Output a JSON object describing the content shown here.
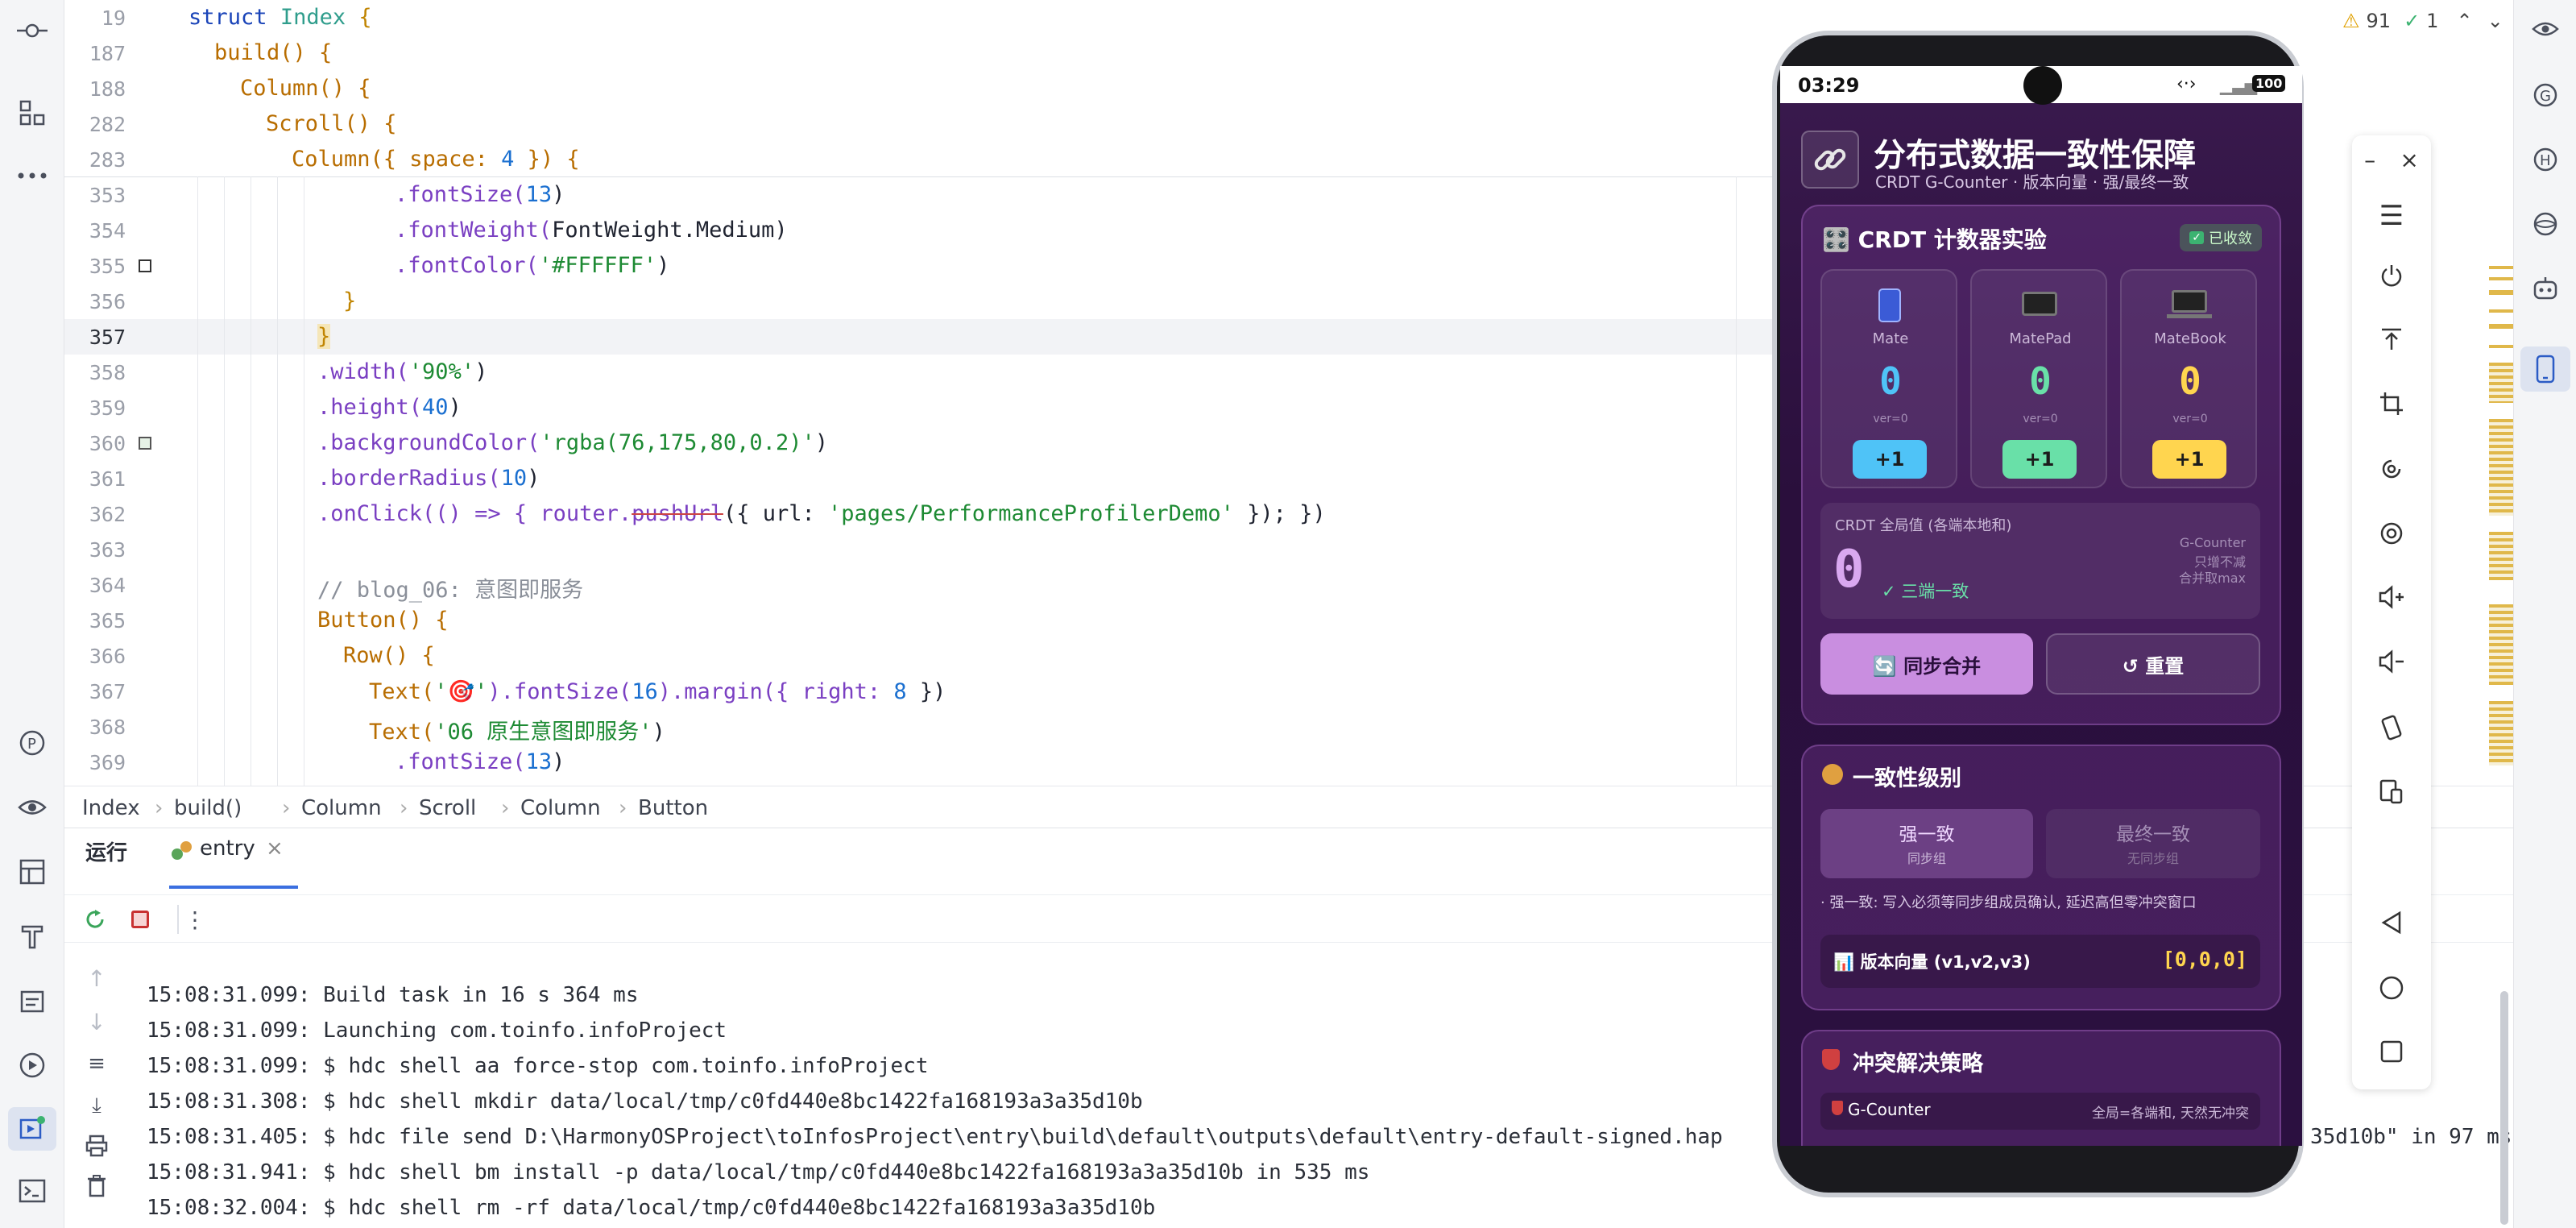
{
  "editor": {
    "lines": [
      {
        "n": "19"
      },
      {
        "n": "187"
      },
      {
        "n": "188"
      },
      {
        "n": "282"
      },
      {
        "n": "283"
      },
      {
        "n": "353"
      },
      {
        "n": "354"
      },
      {
        "n": "355"
      },
      {
        "n": "356"
      },
      {
        "n": "357"
      },
      {
        "n": "358"
      },
      {
        "n": "359"
      },
      {
        "n": "360"
      },
      {
        "n": "361"
      },
      {
        "n": "362"
      },
      {
        "n": "363"
      },
      {
        "n": "364"
      },
      {
        "n": "365"
      },
      {
        "n": "366"
      },
      {
        "n": "367"
      },
      {
        "n": "368"
      },
      {
        "n": "369"
      }
    ],
    "code": {
      "l19a": "struct",
      "l19b": "Index",
      "l19c": "{",
      "l187": "build() {",
      "l188": "Column() {",
      "l282": "Scroll() {",
      "l283a": "Column({ space: ",
      "l283b": "4",
      "l283c": " }) {",
      "l353a": ".fontSize(",
      "l353b": "13",
      "l353c": ")",
      "l354a": ".fontWeight(",
      "l354b": "FontWeight",
      "l354c": ".Medium)",
      "l355a": ".fontColor(",
      "l355b": "'#FFFFFF'",
      "l355c": ")",
      "l356": "}",
      "l357": "}",
      "l358a": ".width(",
      "l358b": "'90%'",
      "l358c": ")",
      "l359a": ".height(",
      "l359b": "40",
      "l359c": ")",
      "l360a": ".backgroundColor(",
      "l360b": "'rgba(76,175,80,0.2)'",
      "l360c": ")",
      "l361a": ".borderRadius(",
      "l361b": "10",
      "l361c": ")",
      "l362a": ".onClick(() => { router.",
      "l362b": "pushUrl",
      "l362c": "({ url: ",
      "l362d": "'pages/PerformanceProfilerDemo'",
      "l362e": " }); })",
      "l364": "// blog_06: 意图即服务",
      "l365": "Button() {",
      "l366": "Row() {",
      "l367a": "Text(",
      "l367b": "'🎯'",
      "l367c": ").fontSize(",
      "l367d": "16",
      "l367e": ").margin({ right: ",
      "l367f": "8",
      "l367g": " })",
      "l368a": "Text(",
      "l368b": "'06 原生意图即服务'",
      "l368c": ")",
      "l369a": ".fontSize(",
      "l369b": "13",
      "l369c": ")"
    },
    "problems": {
      "warnings": "91",
      "ok": "1"
    }
  },
  "breadcrumb": [
    "Index",
    "build()",
    "Column",
    "Scroll",
    "Column",
    "Button"
  ],
  "run_panel": {
    "tab_run": "运行",
    "tab_entry": "entry",
    "console": [
      "15:08:31.099: Build task in 16 s 364 ms",
      "15:08:31.099: Launching com.toinfo.infoProject",
      "15:08:31.099: $ hdc shell aa force-stop com.toinfo.infoProject",
      "15:08:31.308: $ hdc shell mkdir data/local/tmp/c0fd440e8bc1422fa168193a3a35d10b",
      "15:08:31.405: $ hdc file send D:\\HarmonyOSProject\\toInfosProject\\entry\\build\\default\\outputs\\default\\entry-default-signed.hap",
      "15:08:31.941: $ hdc shell bm install -p data/local/tmp/c0fd440e8bc1422fa168193a3a35d10b in 535 ms",
      "15:08:32.004: $ hdc shell rm -rf data/local/tmp/c0fd440e8bc1422fa168193a3a35d10b"
    ],
    "console_overflow": "35d10b\" in 97 ms"
  },
  "phone": {
    "time": "03:29",
    "battery": "100",
    "app_title": "分布式数据一致性保障",
    "app_subtitle": "CRDT G-Counter · 版本向量 · 强/最终一致",
    "crdt_card": {
      "title": "🎛️ CRDT 计数器实验",
      "badge": "已收敛",
      "devices": [
        {
          "name": "Mate",
          "value": "0",
          "ver": "ver=0",
          "button": "+1",
          "color": "#4fc3f7"
        },
        {
          "name": "MatePad",
          "value": "0",
          "ver": "ver=0",
          "button": "+1",
          "color": "#69e0a8"
        },
        {
          "name": "MateBook",
          "value": "0",
          "ver": "ver=0",
          "button": "+1",
          "color": "#ffd54f"
        }
      ],
      "global_label": "CRDT 全局值 (各端本地和)",
      "global_value": "0",
      "global_status": "✓ 三端一致",
      "global_note1": "G-Counter",
      "global_note2": "只增不减",
      "global_note3": "合并取max",
      "sync_button": "🔄 同步合并",
      "reset_button": "↺ 重置"
    },
    "consistency_card": {
      "title": "一致性级别",
      "strong_label": "强一致",
      "strong_sub": "同步组",
      "eventual_label": "最终一致",
      "eventual_sub": "无同步组",
      "desc": "· 强一致: 写入必须等同步组成员确认, 延迟高但零冲突窗口",
      "vector_label": "📊 版本向量 (v1,v2,v3)",
      "vector_value": "[0,0,0]"
    },
    "conflict_card": {
      "title": "冲突解决策略",
      "row_label": "G-Counter",
      "row_value": "全局=各端和, 天然无冲突"
    }
  }
}
